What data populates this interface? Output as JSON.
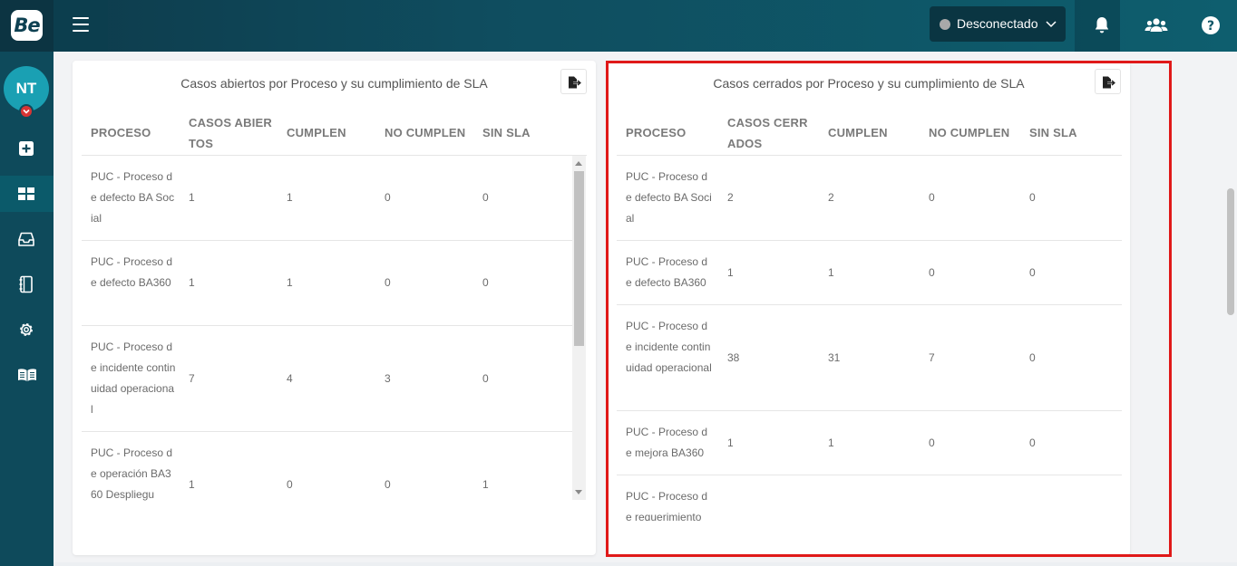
{
  "app": {
    "logo_text": "Be"
  },
  "topbar": {
    "status_label": "Desconectado",
    "status_color": "#a9a9a9",
    "icons": [
      "menu-icon",
      "bell-icon",
      "users-icon",
      "help-icon"
    ]
  },
  "sidebar": {
    "avatar_initials": "NT",
    "items": [
      {
        "icon": "add-icon"
      },
      {
        "icon": "dashboard-icon",
        "active": true
      },
      {
        "icon": "inbox-icon"
      },
      {
        "icon": "notebook-icon"
      },
      {
        "icon": "gear-icon"
      },
      {
        "icon": "book-icon"
      }
    ]
  },
  "left_panel": {
    "title": "Casos abiertos por Proceso y su cumplimiento de SLA",
    "headers": [
      "PROCESO",
      "CASOS ABIER TOS",
      "CUMPLEN",
      "NO CUMPLEN",
      "SIN SLA"
    ],
    "rows": [
      {
        "proceso": "PUC - Proceso de defecto BA Social",
        "casos": "1",
        "cumplen": "1",
        "no_cumplen": "0",
        "sin_sla": "0"
      },
      {
        "proceso": "PUC - Proceso de defecto BA360",
        "casos": "1",
        "cumplen": "1",
        "no_cumplen": "0",
        "sin_sla": "0"
      },
      {
        "proceso": "PUC - Proceso de incidente continuidad operacional",
        "casos": "7",
        "cumplen": "4",
        "no_cumplen": "3",
        "sin_sla": "0"
      },
      {
        "proceso": "PUC - Proceso de operación BA360 Despliegu",
        "casos": "1",
        "cumplen": "0",
        "no_cumplen": "0",
        "sin_sla": "1"
      }
    ]
  },
  "right_panel": {
    "title": "Casos cerrados por Proceso y su cumplimiento de SLA",
    "headers": [
      "PROCESO",
      "CASOS CERR ADOS",
      "CUMPLEN",
      "NO CUMPLEN",
      "SIN SLA"
    ],
    "rows": [
      {
        "proceso": "PUC - Proceso de defecto BA Social",
        "casos": "2",
        "cumplen": "2",
        "no_cumplen": "0",
        "sin_sla": "0"
      },
      {
        "proceso": "PUC - Proceso de defecto BA360",
        "casos": "1",
        "cumplen": "1",
        "no_cumplen": "0",
        "sin_sla": "0"
      },
      {
        "proceso": "PUC - Proceso de incidente continuidad operacional",
        "casos": "38",
        "cumplen": "31",
        "no_cumplen": "7",
        "sin_sla": "0"
      },
      {
        "proceso": "PUC - Proceso de mejora BA360",
        "casos": "1",
        "cumplen": "1",
        "no_cumplen": "0",
        "sin_sla": "0"
      },
      {
        "proceso": "PUC - Proceso de requerimiento",
        "casos": "",
        "cumplen": "",
        "no_cumplen": "",
        "sin_sla": ""
      }
    ]
  },
  "colors": {
    "highlight": "#e01919",
    "topbar": "#0f4d5f",
    "sidebar": "#0e4a5b"
  }
}
